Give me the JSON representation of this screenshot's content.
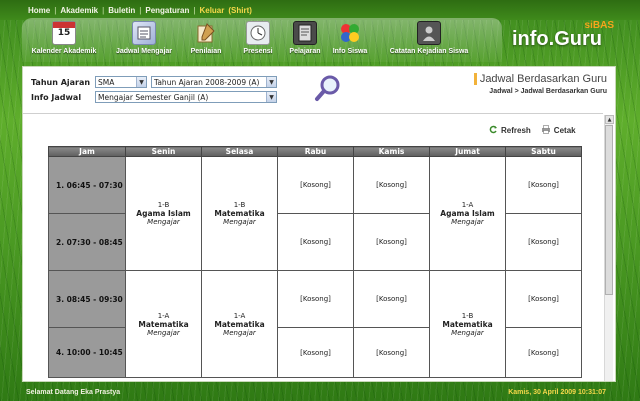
{
  "topmenu": {
    "items": [
      "Home",
      "Akademik",
      "Buletin",
      "Pengaturan",
      "Keluar"
    ],
    "extra": "(Shirt)"
  },
  "toolbar": {
    "items": [
      {
        "label": "Kalender Akademik",
        "icon": "calendar-icon",
        "badge": "15"
      },
      {
        "label": "Jadwal Mengajar",
        "icon": "schedule-icon"
      },
      {
        "label": "Penilaian",
        "icon": "grading-icon"
      },
      {
        "label": "Presensi",
        "icon": "attendance-icon"
      },
      {
        "label": "Pelajaran",
        "icon": "lesson-icon"
      },
      {
        "label": "Info Siswa",
        "icon": "students-icon"
      },
      {
        "label": "Catatan Kejadian Siswa",
        "icon": "incident-notes-icon"
      }
    ]
  },
  "brand": {
    "name": "info.Guru",
    "tag": "siBAS"
  },
  "filters": {
    "tahun_ajaran_label": "Tahun Ajaran",
    "school_level": "SMA",
    "academic_year": "Tahun Ajaran 2008-2009 (A)",
    "info_jadwal_label": "Info Jadwal",
    "semester": "Mengajar Semester Ganjil (A)"
  },
  "page": {
    "title": "Jadwal Berdasarkan Guru",
    "breadcrumb": "Jadwal  >  Jadwal Berdasarkan Guru"
  },
  "actions": {
    "refresh": "Refresh",
    "print": "Cetak"
  },
  "schedule": {
    "headers": [
      "Jam",
      "Senin",
      "Selasa",
      "Rabu",
      "Kamis",
      "Jumat",
      "Sabtu"
    ],
    "times": [
      "1. 06:45 - 07:30",
      "2. 07:30 - 08:45",
      "3. 08:45 - 09:30",
      "4. 10:00 - 10:45"
    ],
    "empty": "[Kosong]",
    "blocks": {
      "senin_1": {
        "cls": "1-B",
        "subject": "Agama Islam",
        "status": "Mengajar"
      },
      "selasa_1": {
        "cls": "1-B",
        "subject": "Matematika",
        "status": "Mengajar"
      },
      "jumat_1": {
        "cls": "1-A",
        "subject": "Agama Islam",
        "status": "Mengajar"
      },
      "senin_2": {
        "cls": "1-A",
        "subject": "Matematika",
        "status": "Mengajar"
      },
      "selasa_2": {
        "cls": "1-A",
        "subject": "Matematika",
        "status": "Mengajar"
      },
      "jumat_2": {
        "cls": "1-B",
        "subject": "Matematika",
        "status": "Mengajar"
      }
    }
  },
  "footer": {
    "left": "Selamat Datang Eka Prastya",
    "right": "Kamis, 30 April 2009 10:31:07"
  }
}
